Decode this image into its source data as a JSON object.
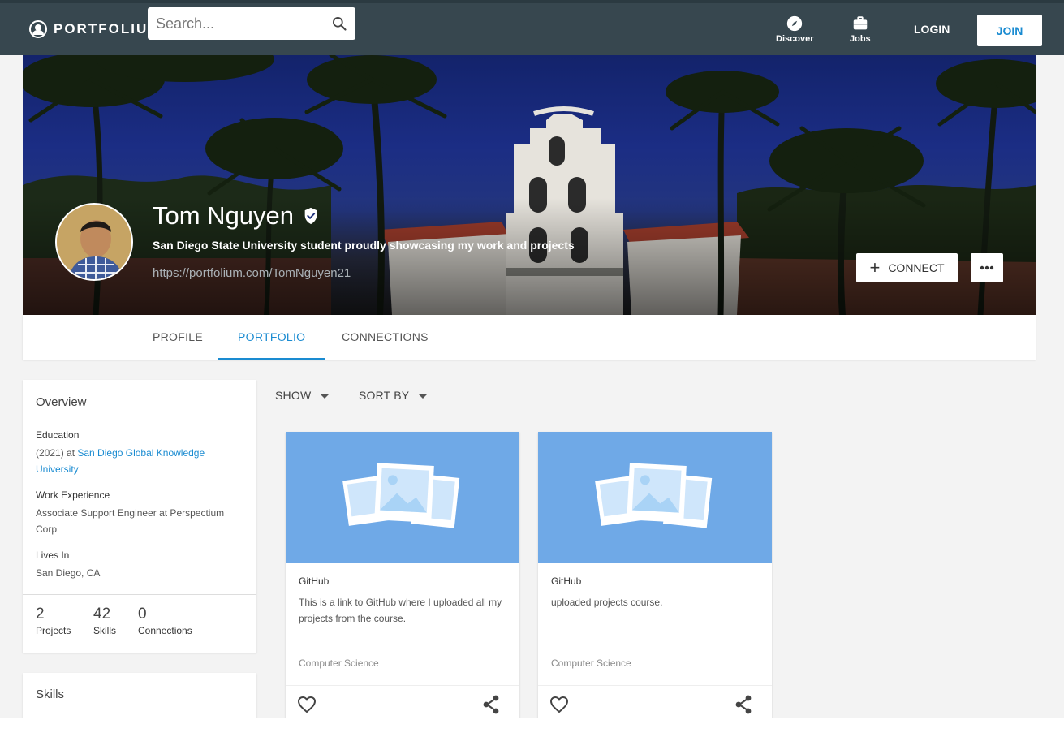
{
  "nav": {
    "logo_text": "PORTFOLIUM",
    "search_placeholder": "Search...",
    "discover_label": "Discover",
    "jobs_label": "Jobs",
    "login_label": "LOGIN",
    "join_label": "JOIN"
  },
  "profile": {
    "name": "Tom Nguyen",
    "tagline": "San Diego State University student proudly showcasing my work and projects",
    "url": "https://portfolium.com/TomNguyen21",
    "connect_label": "CONNECT"
  },
  "tabs": [
    {
      "label": "PROFILE"
    },
    {
      "label": "PORTFOLIO"
    },
    {
      "label": "CONNECTIONS"
    }
  ],
  "overview": {
    "title": "Overview",
    "education_label": "Education",
    "education_prefix": "(2021) at",
    "education_school": "San Diego Global Knowledge University",
    "work_label": "Work Experience",
    "work_value": "Associate Support Engineer at Perspectium Corp",
    "lives_label": "Lives In",
    "lives_value": "San Diego, CA",
    "stats": [
      {
        "value": "2",
        "label": "Projects"
      },
      {
        "value": "42",
        "label": "Skills"
      },
      {
        "value": "0",
        "label": "Connections"
      }
    ]
  },
  "skills": {
    "title": "Skills"
  },
  "filters": {
    "show_label": "SHOW",
    "sort_label": "SORT BY"
  },
  "projects": [
    {
      "title": "GitHub",
      "description": "This is a link to GitHub where I uploaded all my projects from the course.",
      "category": "Computer Science"
    },
    {
      "title": "GitHub",
      "description": "uploaded projects course.",
      "category": "Computer Science"
    }
  ],
  "colors": {
    "nav_bg": "#37474f",
    "accent": "#1a8bd1",
    "thumb_bg": "#6fa9e7"
  }
}
